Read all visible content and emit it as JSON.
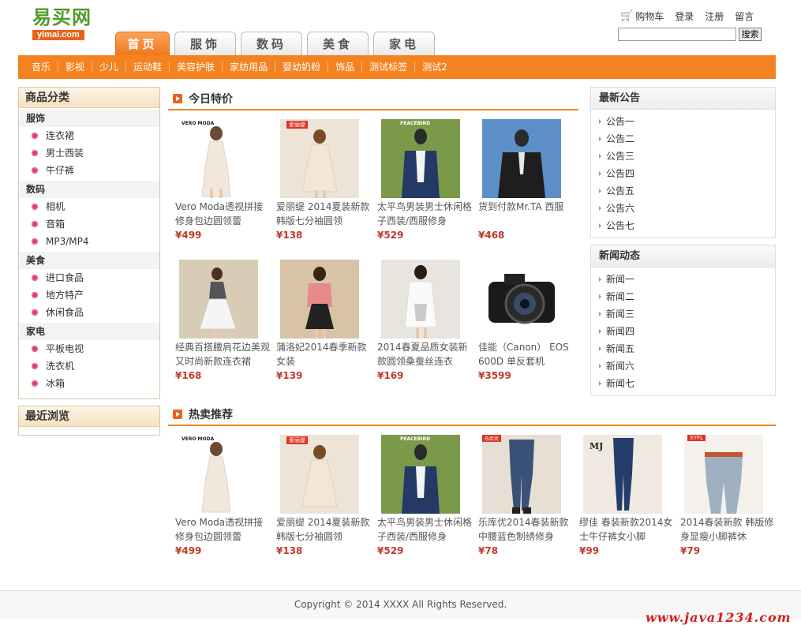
{
  "logo": {
    "cn": "易买网",
    "en": "yimai.com"
  },
  "top_links": {
    "cart": "购物车",
    "login": "登录",
    "register": "注册",
    "message": "留言"
  },
  "search": {
    "button": "搜索",
    "placeholder": ""
  },
  "tabs": [
    "首页",
    "服饰",
    "数码",
    "美食",
    "家电"
  ],
  "sub_nav": [
    "音乐",
    "影视",
    "少儿",
    "运动鞋",
    "美容护肤",
    "家纺用品",
    "婴幼奶粉",
    "饰品",
    "测试标签",
    "测试2"
  ],
  "sidebar": {
    "category_title": "商品分类",
    "groups": [
      {
        "name": "服饰",
        "items": [
          "连衣裙",
          "男士西装",
          "牛仔裤"
        ]
      },
      {
        "name": "数码",
        "items": [
          "相机",
          "音箱",
          "MP3/MP4"
        ]
      },
      {
        "name": "美食",
        "items": [
          "进口食品",
          "地方特产",
          "休闲食品"
        ]
      },
      {
        "name": "家电",
        "items": [
          "平板电视",
          "洗衣机",
          "冰箱"
        ]
      }
    ],
    "recent_title": "最近浏览"
  },
  "deals": {
    "title": "今日特价",
    "products": [
      {
        "name": "Vero Moda透视拼接修身包边圆领蕾",
        "price": "¥499"
      },
      {
        "name": "爱丽缇 2014夏装新款韩版七分袖圆领",
        "price": "¥138"
      },
      {
        "name": "太平鸟男装男士休闲格子西装/西服修身",
        "price": "¥529"
      },
      {
        "name": "货到付款Mr.TA 西服",
        "price": "¥468"
      },
      {
        "name": "经典百搭腰肩花边美观又时尚新款连衣裙",
        "price": "¥168"
      },
      {
        "name": "蒲洛妃2014春季新款女装",
        "price": "¥139"
      },
      {
        "name": "2014春夏品质女装新款圆领桑蚕丝连衣",
        "price": "¥169"
      },
      {
        "name": "佳能（Canon） EOS 600D 单反套机",
        "price": "¥3599"
      }
    ]
  },
  "hot": {
    "title": "热卖推荐",
    "products": [
      {
        "name": "Vero Moda透视拼接修身包边圆领蕾",
        "price": "¥499"
      },
      {
        "name": "爱丽缇 2014夏装新款韩版七分袖圆领",
        "price": "¥138"
      },
      {
        "name": "太平鸟男装男士休闲格子西装/西服修身",
        "price": "¥529"
      },
      {
        "name": "乐库优2014春装新款中腰蓝色制绣修身",
        "price": "¥78"
      },
      {
        "name": "缪佳 春装新款2014女士牛仔裤女小脚",
        "price": "¥99"
      },
      {
        "name": "2014春装新款 韩版修身显瘦小脚裤休",
        "price": "¥79"
      }
    ]
  },
  "notices": {
    "title": "最新公告",
    "items": [
      "公告一",
      "公告二",
      "公告三",
      "公告四",
      "公告五",
      "公告六",
      "公告七"
    ]
  },
  "news": {
    "title": "新闻动态",
    "items": [
      "新闻一",
      "新闻二",
      "新闻三",
      "新闻四",
      "新闻五",
      "新闻六",
      "新闻七"
    ]
  },
  "pic_labels": {
    "vero": "VERO MODA",
    "aili": "爱丽缇",
    "peace": "PEACEBIRD",
    "mj": "MJ",
    "xyfl": "XYFL",
    "leku": "乐库优"
  },
  "footer": "Copyright © 2014 XXXX All Rights Reserved.",
  "watermark": "www.java1234.com"
}
